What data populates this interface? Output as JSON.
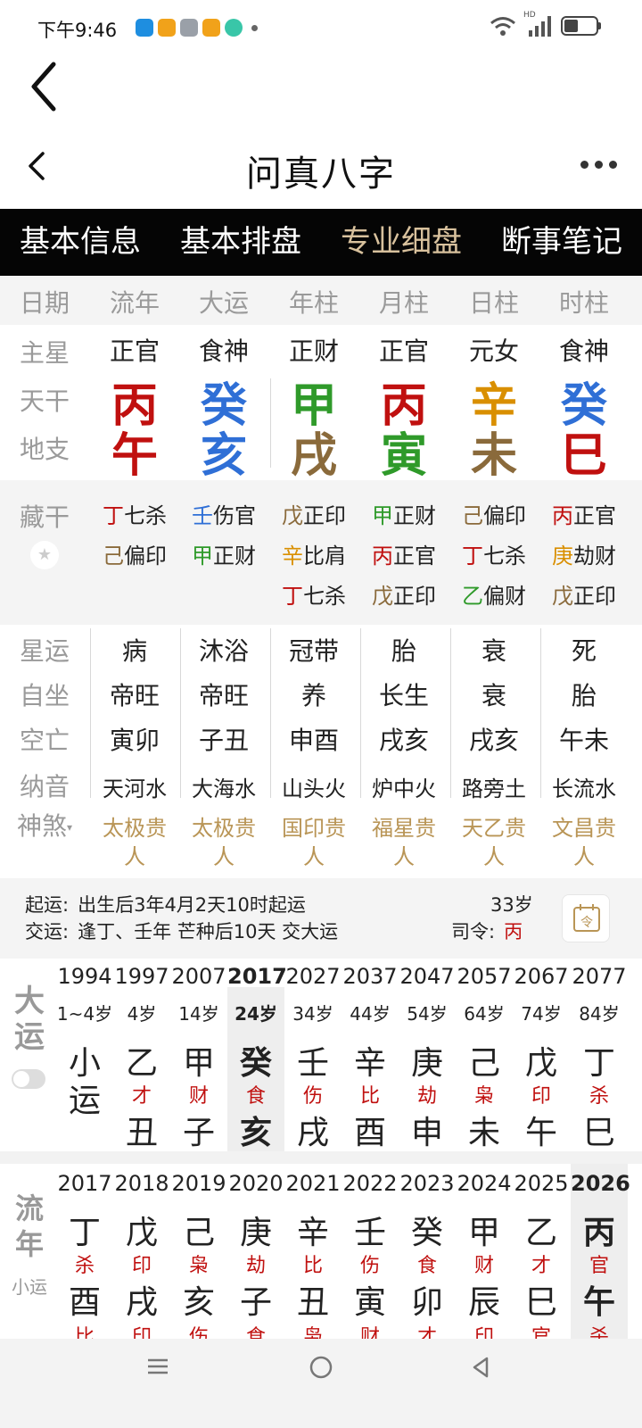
{
  "status": {
    "time": "下午9:46",
    "signal_badge": "HD",
    "battery_level_percent": 45
  },
  "title": "问真八字",
  "tabs": [
    {
      "label": "基本信息",
      "active": false
    },
    {
      "label": "基本排盘",
      "active": false
    },
    {
      "label": "专业细盘",
      "active": true
    },
    {
      "label": "断事笔记",
      "active": false
    }
  ],
  "header": {
    "row_label": "日期",
    "columns": [
      "流年",
      "大运",
      "年柱",
      "月柱",
      "日柱",
      "时柱"
    ]
  },
  "row_labels": {
    "star": "主星",
    "stem": "天干",
    "branch": "地支",
    "hidden": "藏干",
    "xingyun": "星运",
    "zizuo": "自坐",
    "kongwang": "空亡",
    "nayin": "纳音",
    "shensha": "神煞"
  },
  "pillars": [
    {
      "star": "正官",
      "stem": "丙",
      "stem_color": "#c0100f",
      "branch": "午",
      "branch_color": "#c0100f",
      "hidden": [
        {
          "g": "丁",
          "gc": "#c0100f",
          "t": "七杀"
        },
        {
          "g": "己",
          "gc": "#8a6a3b",
          "t": "偏印"
        }
      ],
      "xingyun": "病",
      "zizuo": "帝旺",
      "kongwang": "寅卯",
      "nayin": "天河水",
      "shensha": [
        "太极贵",
        "人"
      ]
    },
    {
      "star": "食神",
      "stem": "癸",
      "stem_color": "#2f6fd6",
      "branch": "亥",
      "branch_color": "#2f6fd6",
      "hidden": [
        {
          "g": "壬",
          "gc": "#2f6fd6",
          "t": "伤官"
        },
        {
          "g": "甲",
          "gc": "#2f9a2a",
          "t": "正财"
        }
      ],
      "xingyun": "沐浴",
      "zizuo": "帝旺",
      "kongwang": "子丑",
      "nayin": "大海水",
      "shensha": [
        "太极贵",
        "人"
      ]
    },
    {
      "star": "正财",
      "stem": "甲",
      "stem_color": "#2f9a2a",
      "branch": "戌",
      "branch_color": "#8a6a3b",
      "hidden": [
        {
          "g": "戊",
          "gc": "#8a6a3b",
          "t": "正印"
        },
        {
          "g": "辛",
          "gc": "#d98f00",
          "t": "比肩"
        },
        {
          "g": "丁",
          "gc": "#c0100f",
          "t": "七杀"
        }
      ],
      "xingyun": "冠带",
      "zizuo": "养",
      "kongwang": "申酉",
      "nayin": "山头火",
      "shensha": [
        "国印贵",
        "人"
      ]
    },
    {
      "star": "正官",
      "stem": "丙",
      "stem_color": "#c0100f",
      "branch": "寅",
      "branch_color": "#2f9a2a",
      "hidden": [
        {
          "g": "甲",
          "gc": "#2f9a2a",
          "t": "正财"
        },
        {
          "g": "丙",
          "gc": "#c0100f",
          "t": "正官"
        },
        {
          "g": "戊",
          "gc": "#8a6a3b",
          "t": "正印"
        }
      ],
      "xingyun": "胎",
      "zizuo": "长生",
      "kongwang": "戌亥",
      "nayin": "炉中火",
      "shensha": [
        "福星贵",
        "人"
      ]
    },
    {
      "star": "元女",
      "stem": "辛",
      "stem_color": "#d98f00",
      "branch": "未",
      "branch_color": "#8a6a3b",
      "hidden": [
        {
          "g": "己",
          "gc": "#8a6a3b",
          "t": "偏印"
        },
        {
          "g": "丁",
          "gc": "#c0100f",
          "t": "七杀"
        },
        {
          "g": "乙",
          "gc": "#2f9a2a",
          "t": "偏财"
        }
      ],
      "xingyun": "衰",
      "zizuo": "衰",
      "kongwang": "戌亥",
      "nayin": "路旁土",
      "shensha": [
        "天乙贵",
        "人"
      ]
    },
    {
      "star": "食神",
      "stem": "癸",
      "stem_color": "#2f6fd6",
      "branch": "巳",
      "branch_color": "#c0100f",
      "hidden": [
        {
          "g": "丙",
          "gc": "#c0100f",
          "t": "正官"
        },
        {
          "g": "庚",
          "gc": "#d98f00",
          "t": "劫财"
        },
        {
          "g": "戊",
          "gc": "#8a6a3b",
          "t": "正印"
        }
      ],
      "xingyun": "死",
      "zizuo": "胎",
      "kongwang": "午未",
      "nayin": "长流水",
      "shensha": [
        "文昌贵",
        "人"
      ]
    }
  ],
  "info": {
    "qiyun_label": "起运:",
    "qiyun_text": "出生后3年4月2天10时起运",
    "jiaoyun_label": "交运:",
    "jiaoyun_text": "逢丁、壬年 芒种后10天 交大运",
    "age": "33岁",
    "siling_label": "司令:",
    "siling_value": "丙",
    "ling_icon_text": "令"
  },
  "dayun": {
    "side_title": [
      "大",
      "运"
    ],
    "items": [
      {
        "year": "1994",
        "age": "1~4岁",
        "stem": "小",
        "god": "",
        "branch": "运",
        "sub": "",
        "selected": false,
        "xiaoyun": true
      },
      {
        "year": "1997",
        "age": "4岁",
        "stem": "乙",
        "god": "才",
        "branch": "丑",
        "sub": "",
        "selected": false
      },
      {
        "year": "2007",
        "age": "14岁",
        "stem": "甲",
        "god": "财",
        "branch": "子",
        "sub": "",
        "selected": false
      },
      {
        "year": "2017",
        "age": "24岁",
        "stem": "癸",
        "god": "食",
        "branch": "亥",
        "sub": "",
        "selected": true
      },
      {
        "year": "2027",
        "age": "34岁",
        "stem": "壬",
        "god": "伤",
        "branch": "戌",
        "sub": "",
        "selected": false
      },
      {
        "year": "2037",
        "age": "44岁",
        "stem": "辛",
        "god": "比",
        "branch": "酉",
        "sub": "",
        "selected": false
      },
      {
        "year": "2047",
        "age": "54岁",
        "stem": "庚",
        "god": "劫",
        "branch": "申",
        "sub": "",
        "selected": false
      },
      {
        "year": "2057",
        "age": "64岁",
        "stem": "己",
        "god": "枭",
        "branch": "未",
        "sub": "",
        "selected": false
      },
      {
        "year": "2067",
        "age": "74岁",
        "stem": "戊",
        "god": "印",
        "branch": "午",
        "sub": "",
        "selected": false
      },
      {
        "year": "2077",
        "age": "84岁",
        "stem": "丁",
        "god": "杀",
        "branch": "巳",
        "sub": "",
        "selected": false
      }
    ]
  },
  "liunian": {
    "side_title": [
      "流",
      "年"
    ],
    "side_sub": "小运",
    "items": [
      {
        "year": "2017",
        "stem": "丁",
        "god": "杀",
        "branch": "酉",
        "sub": "比",
        "selected": false
      },
      {
        "year": "2018",
        "stem": "戊",
        "god": "印",
        "branch": "戌",
        "sub": "印",
        "selected": false
      },
      {
        "year": "2019",
        "stem": "己",
        "god": "枭",
        "branch": "亥",
        "sub": "伤",
        "selected": false
      },
      {
        "year": "2020",
        "stem": "庚",
        "god": "劫",
        "branch": "子",
        "sub": "食",
        "selected": false
      },
      {
        "year": "2021",
        "stem": "辛",
        "god": "比",
        "branch": "丑",
        "sub": "枭",
        "selected": false
      },
      {
        "year": "2022",
        "stem": "壬",
        "god": "伤",
        "branch": "寅",
        "sub": "财",
        "selected": false
      },
      {
        "year": "2023",
        "stem": "癸",
        "god": "食",
        "branch": "卯",
        "sub": "才",
        "selected": false
      },
      {
        "year": "2024",
        "stem": "甲",
        "god": "财",
        "branch": "辰",
        "sub": "印",
        "selected": false
      },
      {
        "year": "2025",
        "stem": "乙",
        "god": "才",
        "branch": "巳",
        "sub": "官",
        "selected": false
      },
      {
        "year": "2026",
        "stem": "丙",
        "god": "官",
        "branch": "午",
        "sub": "杀",
        "selected": true
      }
    ]
  },
  "colors": {
    "tab_active": "#d8c19d",
    "god_red": "#c0100f",
    "label_gray": "#9a9a9a",
    "shensha_gold": "#b99556"
  }
}
